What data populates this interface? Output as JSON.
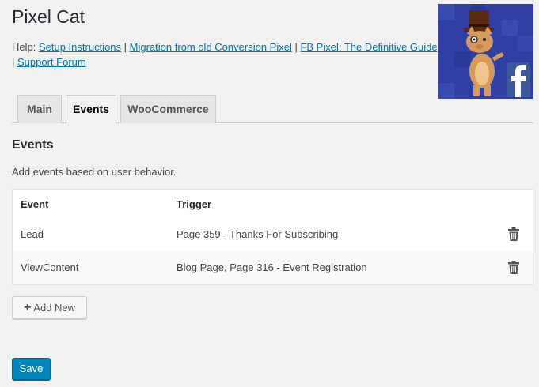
{
  "page": {
    "title": "Pixel Cat",
    "help_prefix": "Help: ",
    "help_links": [
      "Setup Instructions",
      "Migration from old Conversion Pixel",
      "FB Pixel: The Definitive Guide",
      "Support Forum"
    ],
    "separator": " | "
  },
  "logo": {
    "icon": "pixel-cat-logo-with-facebook-f",
    "background": "#2f3fa3"
  },
  "tabs": [
    {
      "label": "Main",
      "active": false
    },
    {
      "label": "Events",
      "active": true
    },
    {
      "label": "WooCommerce",
      "active": false
    }
  ],
  "events": {
    "title": "Events",
    "description": "Add events based on user behavior.",
    "columns": {
      "event": "Event",
      "trigger": "Trigger"
    },
    "rows": [
      {
        "event": "Lead",
        "trigger": "Page 359 - Thanks For Subscribing",
        "icon": "trash-icon"
      },
      {
        "event": "ViewContent",
        "trigger": "Blog Page, Page 316 - Event Registration",
        "icon": "trash-icon"
      }
    ],
    "add_label": "Add New"
  },
  "actions": {
    "save_label": "Save"
  },
  "colors": {
    "link": "#0073aa",
    "primary": "#0085ba",
    "background": "#f1f1f1"
  }
}
